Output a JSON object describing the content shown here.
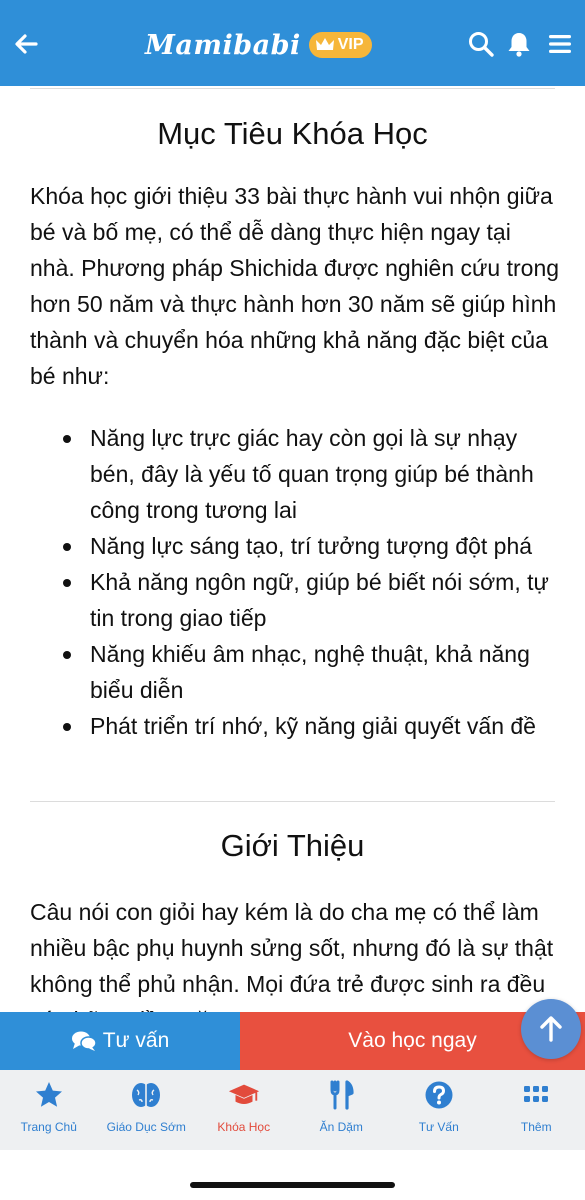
{
  "header": {
    "logo_text": "Mamibabi",
    "vip_label": "VIP",
    "icons": [
      "back-arrow-icon",
      "search-icon",
      "bell-icon",
      "menu-icon"
    ]
  },
  "section_goal": {
    "title": "Mục Tiêu Khóa Học",
    "paragraph": "Khóa học giới thiệu 33 bài thực hành vui nhộn giữa bé và bố mẹ, có thể dễ dàng thực hiện ngay tại nhà. Phương pháp Shichida được nghiên cứu trong hơn 50 năm và thực hành hơn 30 năm sẽ giúp hình thành và chuyển hóa những khả năng đặc biệt của bé như:",
    "bullets": [
      "Năng lực trực giác hay còn gọi là sự nhạy bén, đây là yếu tố quan trọng giúp bé thành công trong tương lai",
      "Năng lực sáng tạo, trí tưởng tượng đột phá",
      "Khả năng ngôn ngữ, giúp bé biết nói sớm, tự tin trong giao tiếp",
      "Năng khiếu âm nhạc, nghệ thuật, khả năng biểu diễn",
      "Phát triển trí nhớ, kỹ năng giải quyết vấn đề"
    ]
  },
  "section_intro": {
    "title": "Giới Thiệu",
    "paragraph": "Câu nói con giỏi hay kém là do cha mẹ có thể làm nhiều bậc phụ huynh sửng sốt, nhưng đó là sự thật không thể phủ nhận. Mọi đứa trẻ được sinh ra đều có những tiềm năng"
  },
  "actions": {
    "consult_label": "Tư vấn",
    "learn_label": "Vào học ngay"
  },
  "tabs": [
    {
      "label": "Trang Chủ",
      "icon": "star-icon"
    },
    {
      "label": "Giáo Dục Sớm",
      "icon": "brain-icon"
    },
    {
      "label": "Khóa Học",
      "icon": "graduation-cap-icon",
      "active": true
    },
    {
      "label": "Ăn Dặm",
      "icon": "fork-knife-icon"
    },
    {
      "label": "Tư Vấn",
      "icon": "question-icon"
    },
    {
      "label": "Thêm",
      "icon": "grid-icon"
    }
  ],
  "colors": {
    "brand_blue": "#2f8fd8",
    "cta_red": "#e8503f",
    "vip_gold": "#f6b63a",
    "active_tab": "#e24b3c"
  }
}
